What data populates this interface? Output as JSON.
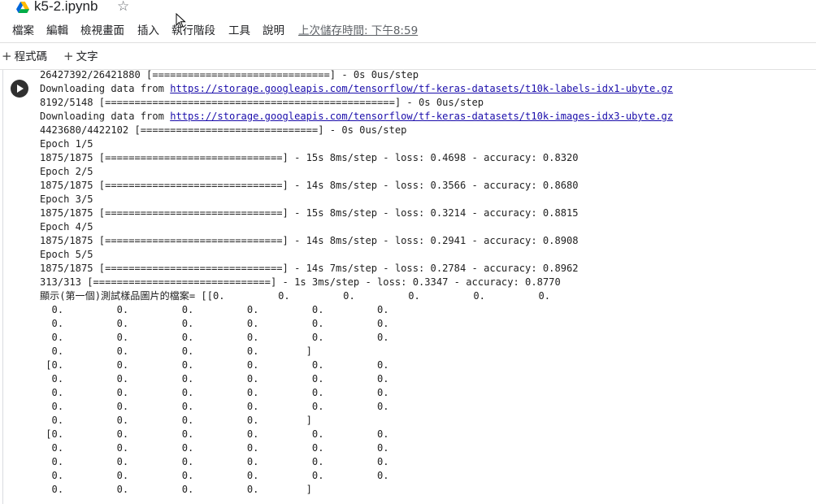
{
  "window": {
    "file_name": "k5-2.ipynb"
  },
  "menu": {
    "items": [
      "檔案",
      "編輯",
      "檢視畫面",
      "插入",
      "執行階段",
      "工具",
      "說明"
    ],
    "last_saved": "上次儲存時間: 下午8:59"
  },
  "toolbar": {
    "add_code": "程式碼",
    "add_text": "文字"
  },
  "output_lines": [
    {
      "text": "26427392/26421880 [==============================] - 0s 0us/step"
    },
    {
      "prefix": "Downloading data from ",
      "link": "https://storage.googleapis.com/tensorflow/tf-keras-datasets/t10k-labels-idx1-ubyte.gz"
    },
    {
      "text": "8192/5148 [=================================================] - 0s 0us/step"
    },
    {
      "prefix": "Downloading data from ",
      "link": "https://storage.googleapis.com/tensorflow/tf-keras-datasets/t10k-images-idx3-ubyte.gz"
    },
    {
      "text": "4423680/4422102 [==============================] - 0s 0us/step"
    },
    {
      "text": "Epoch 1/5"
    },
    {
      "text": "1875/1875 [==============================] - 15s 8ms/step - loss: 0.4698 - accuracy: 0.8320"
    },
    {
      "text": "Epoch 2/5"
    },
    {
      "text": "1875/1875 [==============================] - 14s 8ms/step - loss: 0.3566 - accuracy: 0.8680"
    },
    {
      "text": "Epoch 3/5"
    },
    {
      "text": "1875/1875 [==============================] - 15s 8ms/step - loss: 0.3214 - accuracy: 0.8815"
    },
    {
      "text": "Epoch 4/5"
    },
    {
      "text": "1875/1875 [==============================] - 14s 8ms/step - loss: 0.2941 - accuracy: 0.8908"
    },
    {
      "text": "Epoch 5/5"
    },
    {
      "text": "1875/1875 [==============================] - 14s 7ms/step - loss: 0.2784 - accuracy: 0.8962"
    },
    {
      "text": "313/313 [==============================] - 1s 3ms/step - loss: 0.3347 - accuracy: 0.8770"
    },
    {
      "text": "顯示(第一個)測試樣品圖片的檔案= [[0.         0.         0.         0.         0.         0."
    },
    {
      "text": "  0.         0.         0.         0.         0.         0."
    },
    {
      "text": "  0.         0.         0.         0.         0.         0."
    },
    {
      "text": "  0.         0.         0.         0.         0.         0."
    },
    {
      "text": "  0.         0.         0.         0.        ]"
    },
    {
      "text": " [0.         0.         0.         0.         0.         0."
    },
    {
      "text": "  0.         0.         0.         0.         0.         0."
    },
    {
      "text": "  0.         0.         0.         0.         0.         0."
    },
    {
      "text": "  0.         0.         0.         0.         0.         0."
    },
    {
      "text": "  0.         0.         0.         0.        ]"
    },
    {
      "text": " [0.         0.         0.         0.         0.         0."
    },
    {
      "text": "  0.         0.         0.         0.         0.         0."
    },
    {
      "text": "  0.         0.         0.         0.         0.         0."
    },
    {
      "text": "  0.         0.         0.         0.         0.         0."
    },
    {
      "text": "  0.         0.         0.         0.        ]"
    }
  ],
  "icons": {
    "drive": "google-drive-icon",
    "star": "star-outline-icon",
    "run": "run-cell-icon",
    "cursor": "mouse-pointer-icon"
  }
}
